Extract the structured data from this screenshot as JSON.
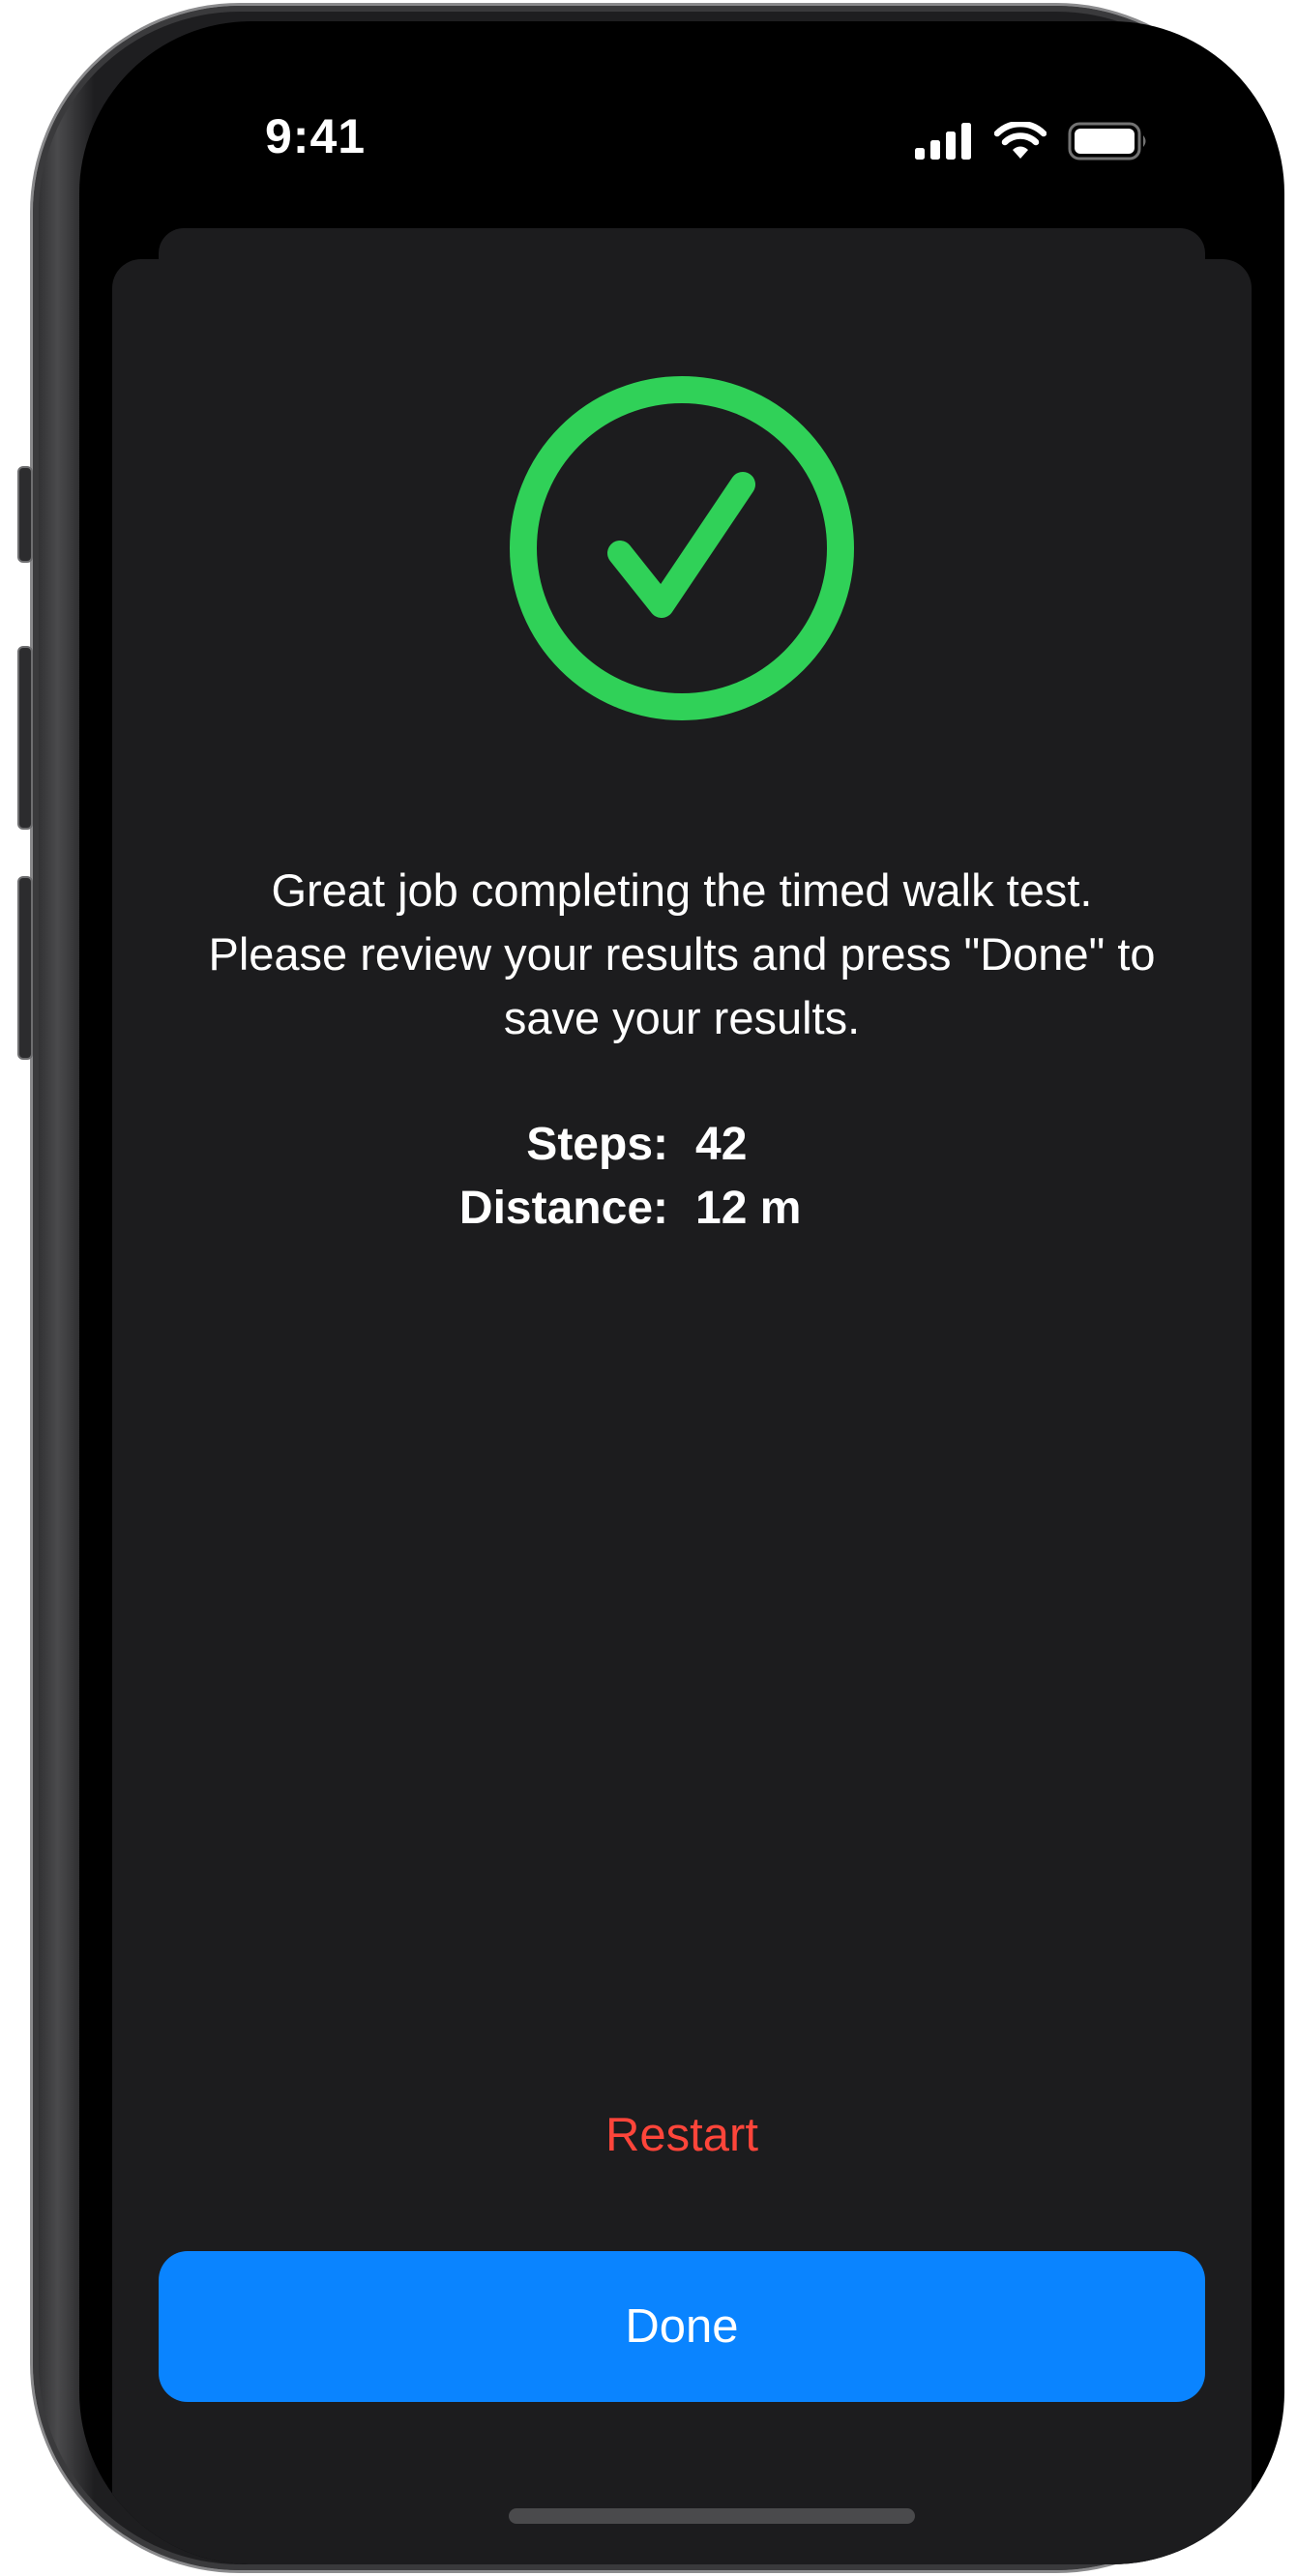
{
  "status_bar": {
    "time": "9:41",
    "icons": [
      "cellular-signal-icon",
      "wifi-icon",
      "battery-icon"
    ]
  },
  "completion": {
    "icon": "checkmark-circle-icon",
    "accent_color": "#30d158",
    "message_lines": [
      "Great job completing the timed walk test.",
      "Please review your results and press \"Done\" to",
      "save your results."
    ]
  },
  "results": [
    {
      "label": "Steps:",
      "value": "42"
    },
    {
      "label": "Distance:",
      "value": "12 m"
    }
  ],
  "actions": {
    "restart_label": "Restart",
    "restart_color": "#ff453a",
    "done_label": "Done",
    "done_color": "#0a84ff"
  }
}
